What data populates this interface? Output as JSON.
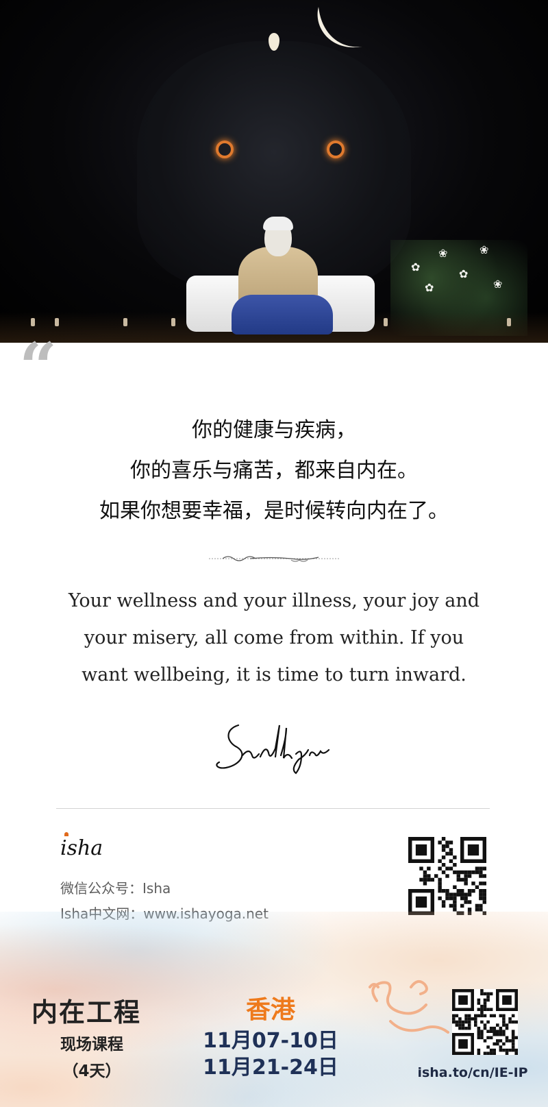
{
  "quote": {
    "cn_lines": [
      "你的健康与疾病，",
      "你的喜乐与痛苦，都来自内在。",
      "如果你想要幸福，是时候转向内在了。"
    ],
    "en_lines": [
      "Your wellness and your illness, your joy and",
      "your misery, all come from within. If you",
      "want wellbeing, it is time to turn inward."
    ],
    "mark": "“"
  },
  "signature": "Sadhguru",
  "contact": {
    "logo": "isha",
    "wechat": "微信公众号：Isha",
    "website": "Isha中文网：www.ishayoga.net"
  },
  "program": {
    "title": "内在工程",
    "subtitle": "现场课程",
    "duration": "（4天）",
    "city": "香港",
    "date1": "11月07-10日",
    "date2": "11月21-24日",
    "register_url": "isha.to/cn/IE-IP"
  },
  "colors": {
    "accent_orange": "#ee7a1c",
    "date_navy": "#1f3157",
    "quote_mark_gray": "#bdbdbd"
  }
}
